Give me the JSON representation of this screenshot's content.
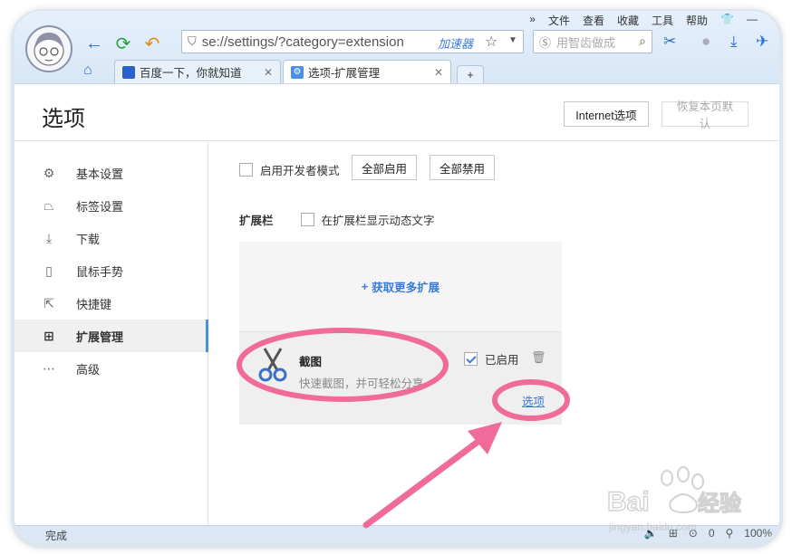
{
  "browser": {
    "menu": [
      "»",
      "文件",
      "查看",
      "收藏",
      "工具",
      "帮助"
    ],
    "address": "se://settings/?category=extension",
    "accelerator": "加速器",
    "search_placeholder": "用智齿做成"
  },
  "tabs": [
    {
      "label": "百度一下，你就知道",
      "active": false
    },
    {
      "label": "选项-扩展管理",
      "active": true
    }
  ],
  "header": {
    "title": "选项",
    "internet_options": "Internet选项",
    "restore_default": "恢复本页默认"
  },
  "sidebar": {
    "items": [
      {
        "label": "基本设置",
        "icon": "gear-icon"
      },
      {
        "label": "标签设置",
        "icon": "tab-icon"
      },
      {
        "label": "下载",
        "icon": "download-icon"
      },
      {
        "label": "鼠标手势",
        "icon": "mouse-icon"
      },
      {
        "label": "快捷键",
        "icon": "shortcut-icon"
      },
      {
        "label": "扩展管理",
        "icon": "extension-icon",
        "active": true
      },
      {
        "label": "高级",
        "icon": "more-icon"
      }
    ]
  },
  "content": {
    "dev_mode": "启用开发者模式",
    "enable_all": "全部启用",
    "disable_all": "全部禁用",
    "extbar_label": "扩展栏",
    "show_dynamic": "在扩展栏显示动态文字",
    "get_more": "获取更多扩展",
    "extension": {
      "name": "截图",
      "description": "快速截图，并可轻松分享",
      "enabled_label": "已启用",
      "enabled": true,
      "options": "选项"
    }
  },
  "status": {
    "left": "完成",
    "zoom": "100%",
    "count": "0"
  },
  "colors": {
    "accent": "#3a7bd5",
    "annotation": "#f06a9a"
  }
}
